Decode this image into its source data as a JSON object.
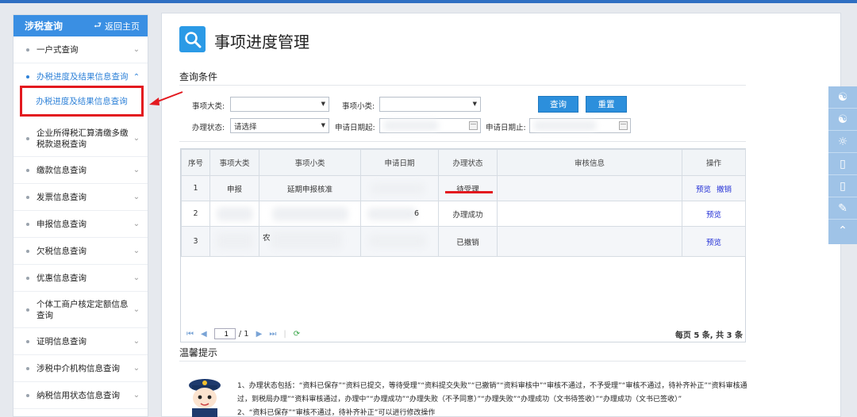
{
  "sidebar": {
    "title": "涉税查询",
    "back_label": "返回主页",
    "items": [
      {
        "label": "一户式查询",
        "chevron": "v",
        "active": false
      },
      {
        "label": "办税进度及结果信息查询",
        "chevron": "^",
        "active": true
      },
      {
        "label": "企业所得税汇算清缴多缴税款退税查询",
        "chevron": "v",
        "active": false
      },
      {
        "label": "缴款信息查询",
        "chevron": "v",
        "active": false
      },
      {
        "label": "发票信息查询",
        "chevron": "v",
        "active": false
      },
      {
        "label": "申报信息查询",
        "chevron": "v",
        "active": false
      },
      {
        "label": "欠税信息查询",
        "chevron": "v",
        "active": false
      },
      {
        "label": "优惠信息查询",
        "chevron": "v",
        "active": false
      },
      {
        "label": "个体工商户核定定额信息查询",
        "chevron": "v",
        "active": false
      },
      {
        "label": "证明信息查询",
        "chevron": "v",
        "active": false
      },
      {
        "label": "涉税中介机构信息查询",
        "chevron": "v",
        "active": false
      },
      {
        "label": "纳税信用状态信息查询",
        "chevron": "v",
        "active": false
      }
    ],
    "sub_item": "办税进度及结果信息查询"
  },
  "main": {
    "title": "事项进度管理",
    "query_section": "查询条件",
    "form": {
      "category_label": "事项大类:",
      "category_value": "",
      "subcategory_label": "事项小类:",
      "subcategory_value": "",
      "status_label": "办理状态:",
      "status_value": "请选择",
      "date_from_label": "申请日期起:",
      "date_to_label": "申请日期止:"
    },
    "buttons": {
      "query": "查询",
      "reset": "重置"
    },
    "table": {
      "headers": [
        "序号",
        "事项大类",
        "事项小类",
        "申请日期",
        "办理状态",
        "审核信息",
        "操作"
      ],
      "rows": [
        {
          "no": "1",
          "category": "申报",
          "subcategory": "延期申报核准",
          "date": "",
          "status": "待受理",
          "audit": "",
          "ops": [
            "预览",
            "撤销"
          ]
        },
        {
          "no": "2",
          "category": "",
          "subcategory": "",
          "date": "6",
          "status": "办理成功",
          "audit": "",
          "ops": [
            "预览"
          ]
        },
        {
          "no": "3",
          "category": "",
          "subcategory": "农",
          "date": "",
          "status": "已撤销",
          "audit": "",
          "ops": [
            "预览"
          ]
        }
      ]
    },
    "pager": {
      "page_input": "1",
      "page_total": "/ 1",
      "info": "每页 5 条, 共 3 条"
    },
    "tips_section": "温馨提示",
    "tips": {
      "line1": "1、办理状态包括：“资料已保存”“资料已提交，等待受理”“资料提交失败”“已撤销”“资料审核中”“审核不通过，不予受理”“审核不通过，待补齐补正”“资料审核通过，到税局办理”“资料审核通过，办理中”“办理成功”“办理失败（不予同意）”“办理失败”“办理成功（文书待签收）”“办理成功（文书已签收）”",
      "line2": "2、“资料已保存”“审核不通过，待补齐补正”可以进行修改操作"
    }
  },
  "floatbar": {
    "icons": [
      "wechat-icon",
      "wechat-icon",
      "weibo-icon",
      "mobile-icon",
      "tablet-icon",
      "edit-icon",
      "back-to-top-icon"
    ]
  },
  "colors": {
    "accent": "#3a8fe3",
    "button": "#2c8fdc",
    "highlight": "#e3191f",
    "link": "#2431d6"
  }
}
